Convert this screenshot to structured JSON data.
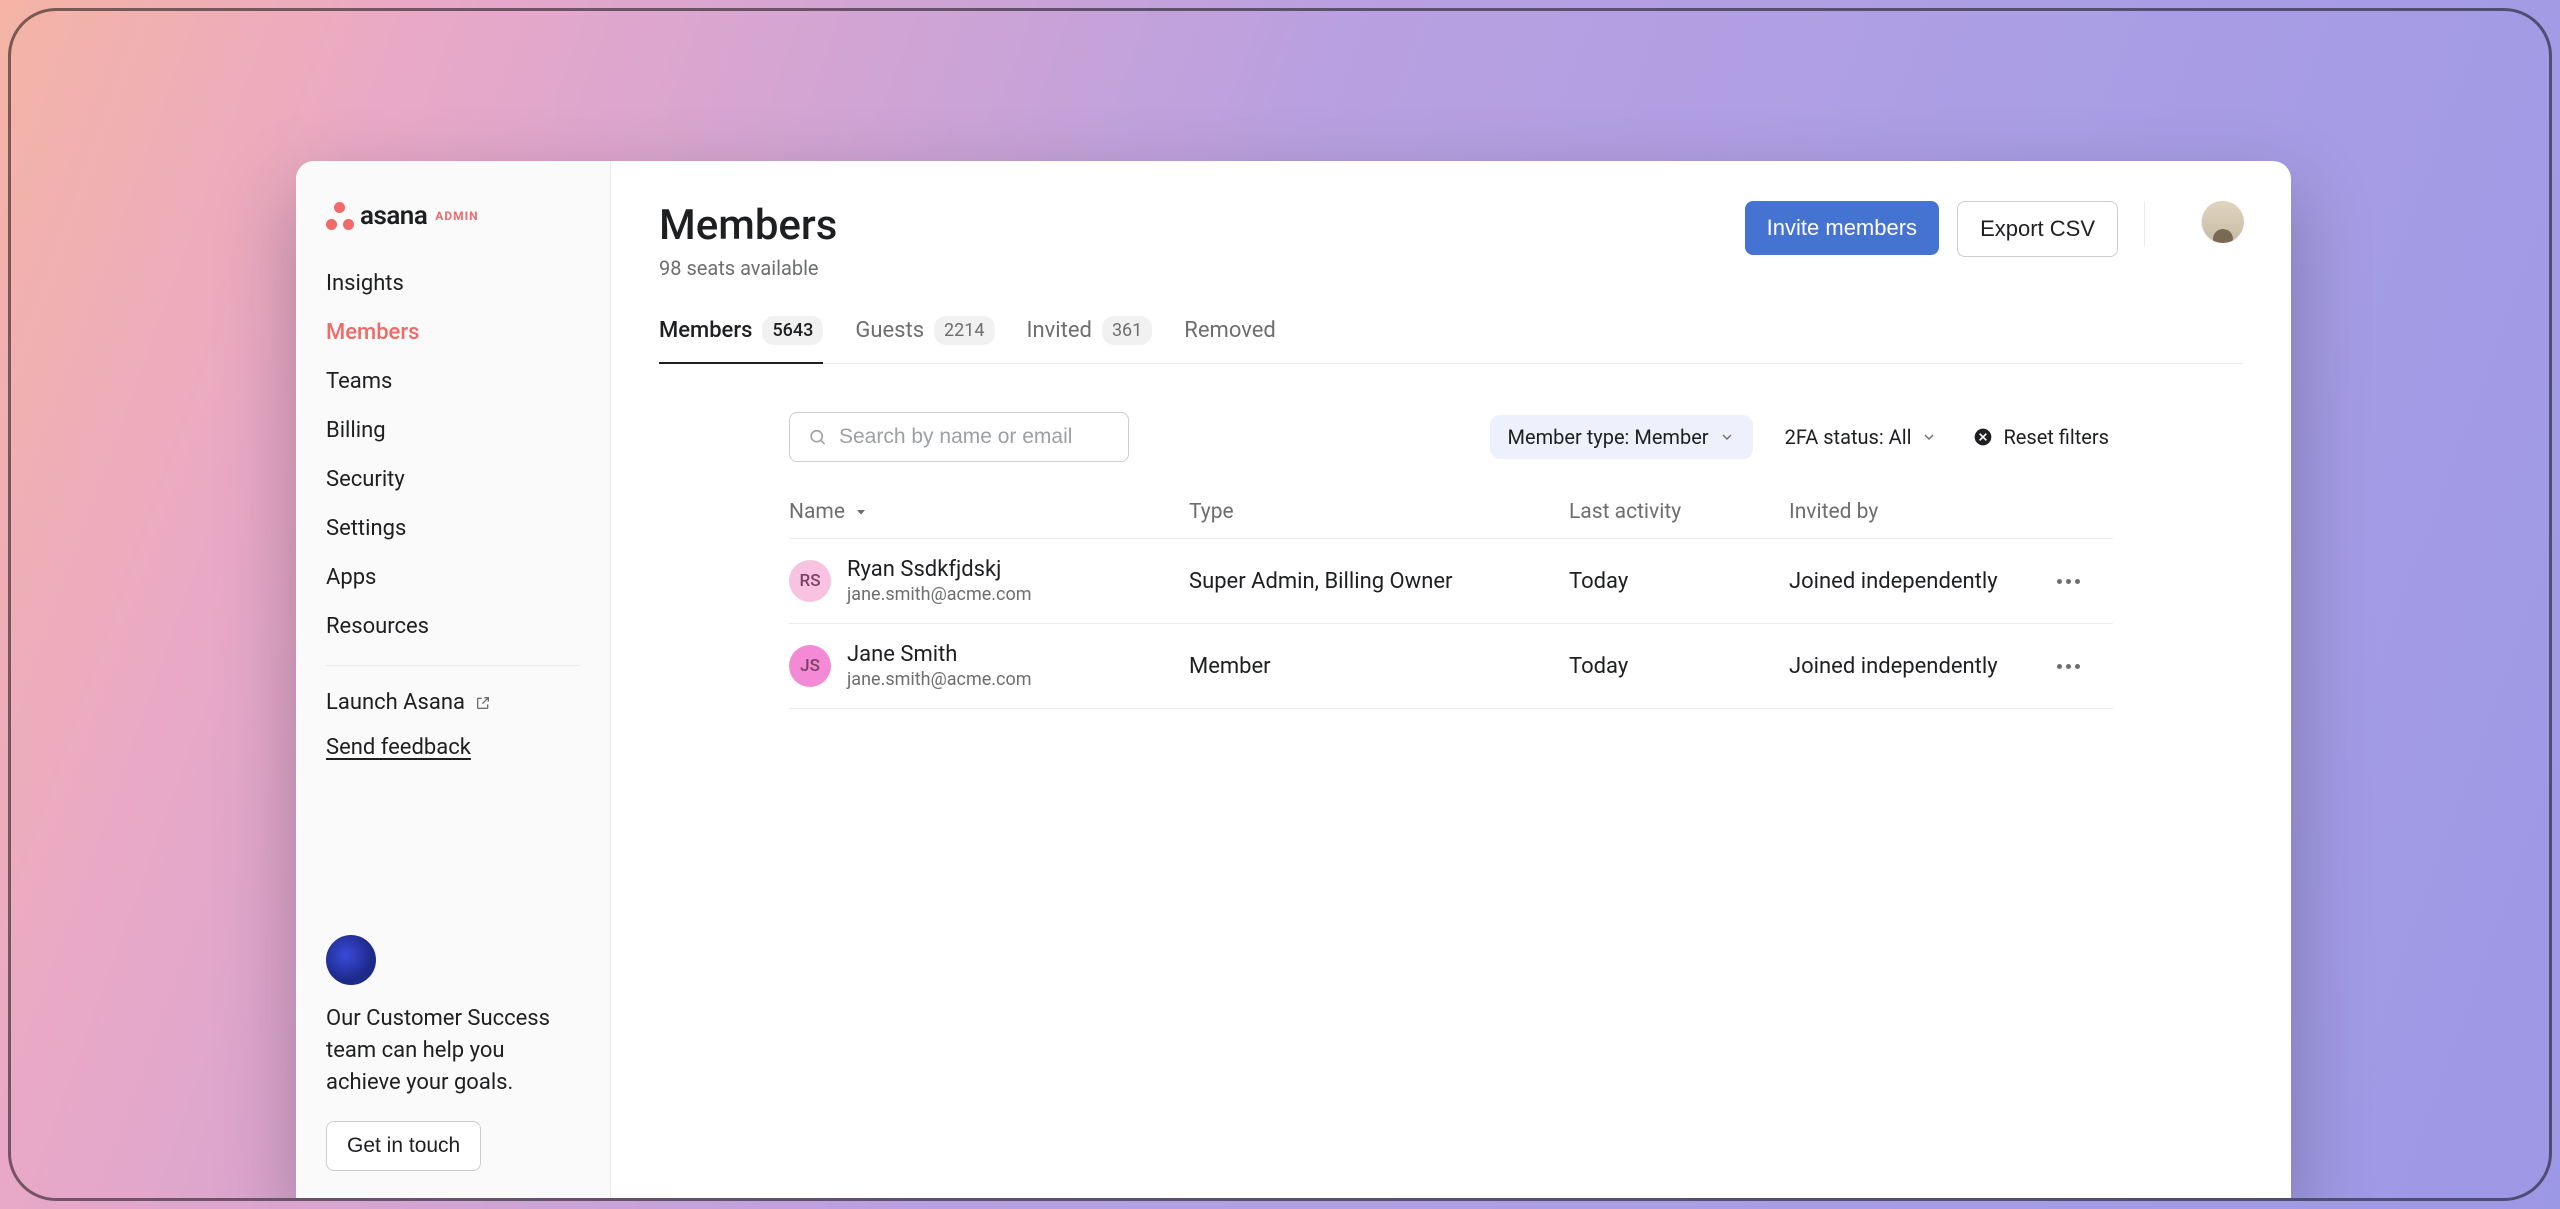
{
  "brand": {
    "name": "asana",
    "admin_tag": "ADMIN"
  },
  "sidebar": {
    "items": [
      {
        "label": "Insights"
      },
      {
        "label": "Members"
      },
      {
        "label": "Teams"
      },
      {
        "label": "Billing"
      },
      {
        "label": "Security"
      },
      {
        "label": "Settings"
      },
      {
        "label": "Apps"
      },
      {
        "label": "Resources"
      }
    ],
    "launch_label": "Launch Asana",
    "feedback_label": "Send feedback",
    "cs_text": "Our Customer Success team can help you achieve your goals.",
    "cs_button": "Get in touch"
  },
  "page": {
    "title": "Members",
    "subtitle": "98 seats available"
  },
  "actions": {
    "invite": "Invite members",
    "export": "Export CSV"
  },
  "tabs": [
    {
      "label": "Members",
      "count": "5643"
    },
    {
      "label": "Guests",
      "count": "2214"
    },
    {
      "label": "Invited",
      "count": "361"
    },
    {
      "label": "Removed",
      "count": ""
    }
  ],
  "toolbar": {
    "search_placeholder": "Search by name or email",
    "member_type_filter": "Member type: Member",
    "tfa_filter": "2FA status: All",
    "reset": "Reset filters"
  },
  "columns": {
    "name": "Name",
    "type": "Type",
    "last_activity": "Last activity",
    "invited_by": "Invited by"
  },
  "rows": [
    {
      "initials": "RS",
      "avatar_bg": "#f7c3e0",
      "name": "Ryan Ssdkfjdskj",
      "email": "jane.smith@acme.com",
      "type": "Super Admin, Billing Owner",
      "last_activity": "Today",
      "invited_by": "Joined independently"
    },
    {
      "initials": "JS",
      "avatar_bg": "#f48ad6",
      "name": "Jane Smith",
      "email": "jane.smith@acme.com",
      "type": "Member",
      "last_activity": "Today",
      "invited_by": "Joined independently"
    }
  ]
}
